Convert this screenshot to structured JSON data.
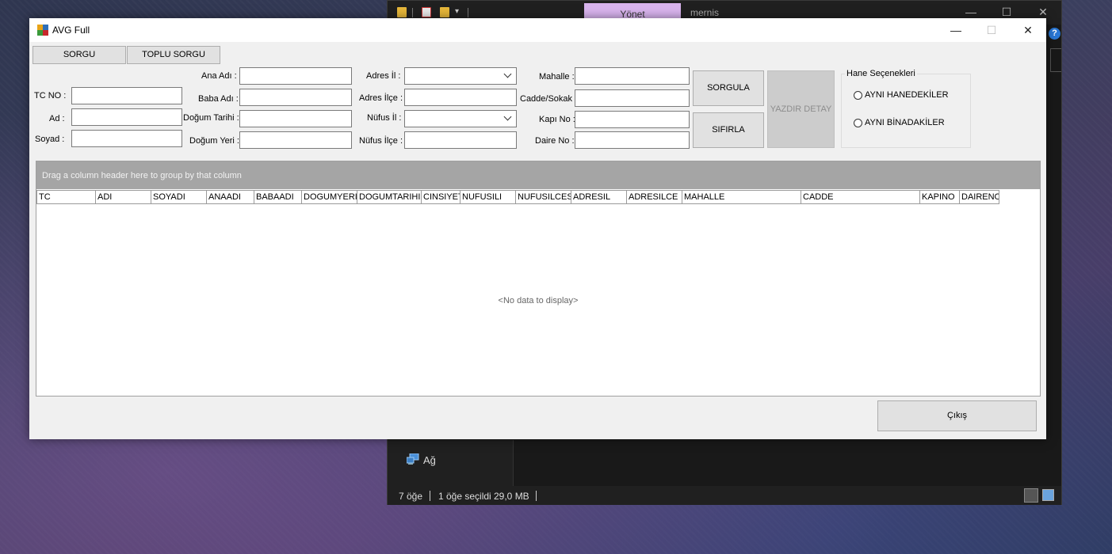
{
  "explorer": {
    "ribbon_tab": "Yönet",
    "title": "mernis",
    "window_controls": {
      "minimize": "—",
      "maximize": "☐",
      "close": "✕"
    },
    "help": "?",
    "nav_item": "Ağ",
    "status": {
      "items": "7 öğe",
      "selected": "1 öğe seçildi",
      "size": "29,0 MB"
    }
  },
  "app": {
    "title": "AVG Full",
    "window_controls": {
      "minimize": "—",
      "maximize": "☐",
      "close": "✕"
    },
    "tabs": [
      {
        "label": "SORGU"
      },
      {
        "label": "TOPLU SORGU"
      }
    ],
    "form": {
      "tc_no_label": "TC NO :",
      "ad_label": "Ad :",
      "soyad_label": "Soyad :",
      "ana_adi_label": "Ana Adı :",
      "baba_adi_label": "Baba Adı :",
      "dogum_tarihi_label": "Doğum Tarihi :",
      "dogum_yeri_label": "Doğum Yeri :",
      "adres_il_label": "Adres İl :",
      "adres_ilce_label": "Adres İlçe :",
      "nufus_il_label": "Nüfus İl :",
      "nufus_ilce_label": "Nüfus İlçe :",
      "mahalle_label": "Mahalle :",
      "cadde_label": "Cadde/Sokak :",
      "kapi_label": "Kapı No :",
      "daire_label": "Daire No :",
      "adres_il_value": "",
      "nufus_il_value": ""
    },
    "buttons": {
      "sorgula": "SORGULA",
      "sifirla": "SIFIRLA",
      "yazdir": "YAZDIR DETAY",
      "exit": "Çıkış"
    },
    "hane": {
      "title": "Hane Seçenekleri",
      "options": [
        {
          "label": "AYNI HANEDEKİLER"
        },
        {
          "label": "AYNI BİNADAKİLER"
        }
      ]
    },
    "grid": {
      "group_hint": "Drag a column header here to group by that column",
      "columns": [
        "TC",
        "ADI",
        "SOYADI",
        "ANAADI",
        "BABAADI",
        "DOGUMYERI",
        "DOGUMTARIHI",
        "CINSIYET",
        "NUFUSILI",
        "NUFUSILCESI",
        "ADRESIL",
        "ADRESILCE",
        "MAHALLE",
        "CADDE",
        "KAPINO",
        "DAIRENO"
      ],
      "empty_text": "<No data to display>"
    }
  }
}
